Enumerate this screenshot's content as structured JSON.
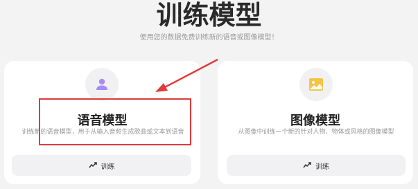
{
  "page": {
    "title": "训练模型",
    "subtitle": "使用您的数据免费训练新的语音或图像模型！"
  },
  "cards": [
    {
      "title": "语音模型",
      "description": "训练新的语音模型，用于从输入音频生成歌曲或文本到语音",
      "icon": "user-icon",
      "button_label": "训练",
      "button_icon": "chart-line-icon"
    },
    {
      "title": "图像模型",
      "description": "从图像中训练一个新的针对人物、物体或风格的图像模型",
      "icon": "image-icon",
      "button_label": "训练",
      "button_icon": "chart-line-icon"
    }
  ],
  "colors": {
    "background": "#f3f3f4",
    "voice_icon": "#a78bfa",
    "image_icon": "#f5c542",
    "annotation": "#e03a3a"
  }
}
